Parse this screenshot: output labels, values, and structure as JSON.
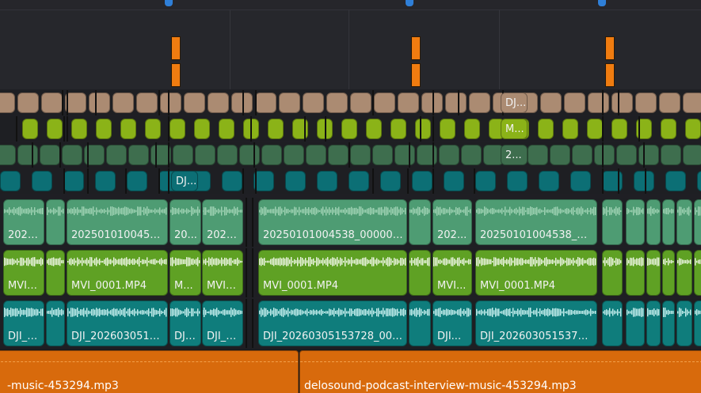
{
  "colors": {
    "track_tan": "#ab8b72",
    "track_lime": "#8bb318",
    "track_darkgreen": "#3e6e4e",
    "track_teal": "#0c6f75",
    "video_green": "#4e9c73",
    "video_lime": "#5fa124",
    "video_teal": "#0f7d7c",
    "audio_orange": "#d86a0c",
    "marker_orange": "#f07c10",
    "playhead_blue": "#2f7fd8"
  },
  "small_tracks": {
    "tan_label": "DJ...",
    "lime_label": "M...",
    "darkgreen_label": "2...",
    "teal_label": "DJ..."
  },
  "video_track_1": [
    {
      "label": "2025..."
    },
    {
      "label": "20250101004533..."
    },
    {
      "label": "20..."
    },
    {
      "label": "2025..."
    },
    {
      "label": "20250101004538_000000..."
    },
    {
      "label": "202..."
    },
    {
      "label": "20250101004538_00..."
    }
  ],
  "video_track_2": [
    {
      "label": "MVI_..."
    },
    {
      "label": "MVI_0001.MP4"
    },
    {
      "label": "M..."
    },
    {
      "label": "MVI_..."
    },
    {
      "label": "MVI_0001.MP4"
    },
    {
      "label": "MVI..."
    },
    {
      "label": "MVI_0001.MP4"
    }
  ],
  "video_track_3": [
    {
      "label": "DJI_2..."
    },
    {
      "label": "DJI_2026030515..."
    },
    {
      "label": "DJI..."
    },
    {
      "label": "DJI_2..."
    },
    {
      "label": "DJI_20260305153728_002..."
    },
    {
      "label": "DJI..."
    },
    {
      "label": "DJI_20260305153728..."
    }
  ],
  "audio_track": [
    {
      "label": "-music-453294.mp3"
    },
    {
      "label": "delosound-podcast-interview-music-453294.mp3"
    }
  ]
}
